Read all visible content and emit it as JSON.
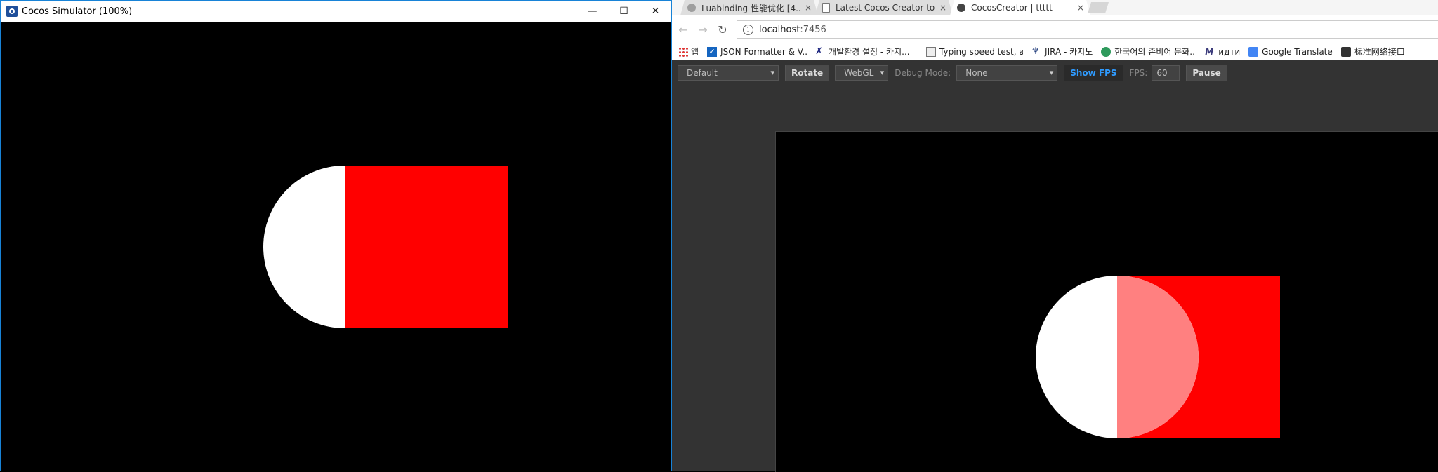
{
  "simulator": {
    "title": "Cocos Simulator (100%)",
    "minimize_glyph": "—",
    "maximize_glyph": "☐",
    "close_glyph": "✕",
    "app_icon": "cocos-icon"
  },
  "browser": {
    "tabs": [
      {
        "label": "Luabinding 性能优化 [4...",
        "close": "×",
        "icon": "speech-bubble-icon"
      },
      {
        "label": "Latest Cocos Creator to...",
        "close": "×",
        "icon": "document-icon"
      },
      {
        "label": "CocosCreator | ttttt",
        "close": "×",
        "icon": "cocos-icon",
        "active": true
      }
    ],
    "nav": {
      "back": "←",
      "forward": "→",
      "reload": "↻"
    },
    "url": {
      "host": "localhost",
      "port": ":7456",
      "info": "i"
    },
    "bookmarks": [
      {
        "label": "앱",
        "icon": "apps-icon"
      },
      {
        "label": "JSON Formatter & V...",
        "icon": "checkbox-icon",
        "color": "#1565c0"
      },
      {
        "label": "개발환경 설정 - 카지...",
        "icon": "tools-icon",
        "color": "#1a237e"
      },
      {
        "label": "Typing speed test, ac...",
        "icon": "page-icon",
        "color": "#555555"
      },
      {
        "label": "JIRA - 카지노",
        "icon": "jira-icon",
        "color": "#1e3a7a"
      },
      {
        "label": "한국어의 존비어 문화...",
        "icon": "circle-icon",
        "color": "#2e9a5c"
      },
      {
        "label": "идти",
        "icon": "m-icon",
        "color": "#3a3a7a"
      },
      {
        "label": "Google Translate",
        "icon": "translate-icon",
        "color": "#4285f4"
      },
      {
        "label": "标准网络接口",
        "icon": "cocos-icon",
        "color": "#222222"
      }
    ]
  },
  "preview_toolbar": {
    "device": "Default",
    "rotate": "Rotate",
    "renderer": "WebGL",
    "debug_label": "Debug Mode:",
    "debug_value": "None",
    "show_fps": "Show FPS",
    "fps_label": "FPS:",
    "fps_value": "60",
    "pause": "Pause"
  },
  "colors": {
    "sprite_red": "#ff0000",
    "sprite_white": "#ffffff",
    "overlap_pink": "#ff8080",
    "accent_blue": "#2f9bff"
  }
}
